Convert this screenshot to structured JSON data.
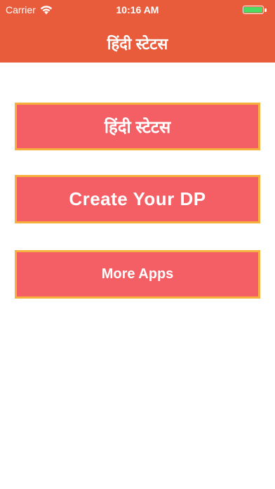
{
  "status_bar": {
    "carrier": "Carrier",
    "time": "10:16 AM",
    "battery_color": "#4cd964"
  },
  "header": {
    "title": "हिंदी स्टेटस",
    "background": "#e85c3b"
  },
  "buttons": [
    {
      "label": "हिंदी स्टेटस"
    },
    {
      "label": "Create Your DP"
    },
    {
      "label": "More Apps"
    }
  ],
  "colors": {
    "button_fill": "#f45f65",
    "button_border": "#f6b03d"
  }
}
